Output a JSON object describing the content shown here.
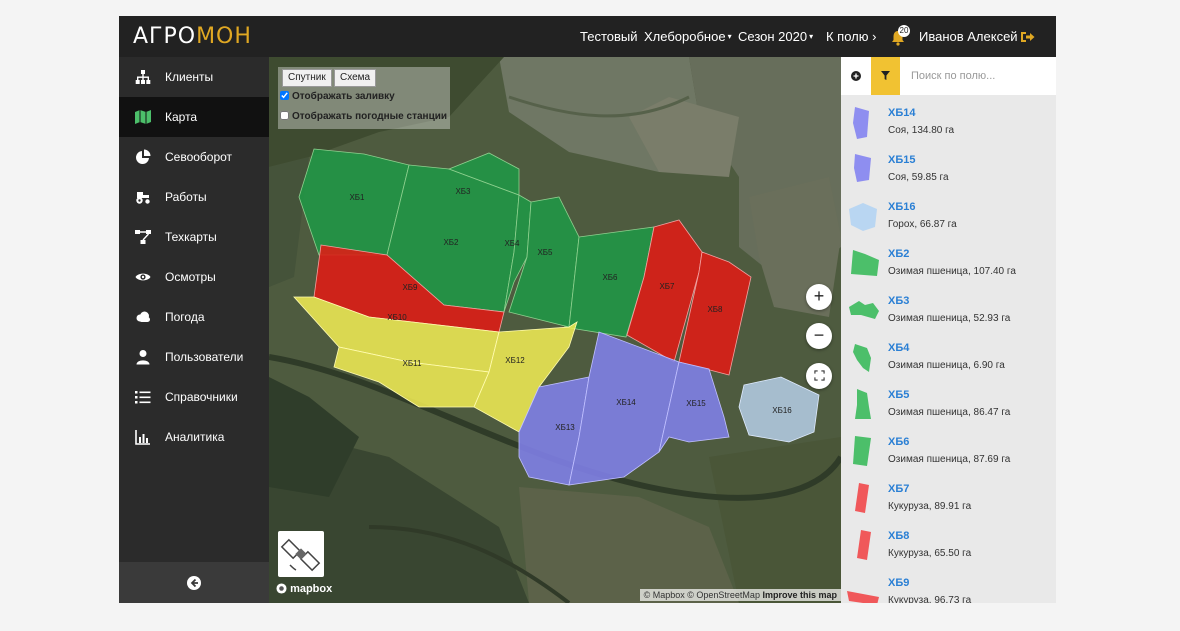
{
  "app": {
    "logo_a": "АГРО",
    "logo_b": "МОН",
    "org": "Тестовый",
    "farm": "Хлеборобное",
    "season": "Сезон 2020",
    "to_field": "К полю",
    "to_field_arrow": "›",
    "caret": "▾",
    "notifications": "20",
    "user": "Иванов Алексей",
    "accent": "#e0a823"
  },
  "sidebar": {
    "items": [
      {
        "label": "Клиенты",
        "icon": "org-chart-icon"
      },
      {
        "label": "Карта",
        "icon": "map-icon"
      },
      {
        "label": "Севооборот",
        "icon": "pie-chart-icon"
      },
      {
        "label": "Работы",
        "icon": "tractor-icon"
      },
      {
        "label": "Техкарты",
        "icon": "flow-icon"
      },
      {
        "label": "Осмотры",
        "icon": "eye-icon"
      },
      {
        "label": "Погода",
        "icon": "cloud-icon"
      },
      {
        "label": "Пользователи",
        "icon": "user-icon"
      },
      {
        "label": "Справочники",
        "icon": "list-icon"
      },
      {
        "label": "Аналитика",
        "icon": "bar-chart-icon"
      }
    ],
    "active": "Карта"
  },
  "map": {
    "tab_satellite": "Спутник",
    "tab_scheme": "Схема",
    "show_fill": "Отображать заливку",
    "show_fill_checked": true,
    "show_weather": "Отображать погодные станции",
    "show_weather_checked": false,
    "zoom_in": "+",
    "zoom_out": "−",
    "mapbox": "mapbox",
    "attribution": "© Mapbox © OpenStreetMap",
    "improve": "Improve this map",
    "labels": {
      "xb1": "ХБ1",
      "xb2": "ХБ2",
      "xb3": "ХБ3",
      "xb4": "ХБ4",
      "xb5": "ХБ5",
      "xb6": "ХБ6",
      "xb7": "ХБ7",
      "xb8": "ХБ8",
      "xb9": "ХБ9",
      "xb10": "ХБ10",
      "xb11": "ХБ11",
      "xb12": "ХБ12",
      "xb13": "ХБ13",
      "xb14": "ХБ14",
      "xb15": "ХБ15",
      "xb16": "ХБ16"
    }
  },
  "crop_colors": {
    "soy": "#8e8ef0",
    "peas": "#b9d6f2",
    "wheat": "#4cbf6a",
    "corn": "#f0585a",
    "sunflower": "#ecec5a"
  },
  "panel": {
    "search_placeholder": "Поиск по полю...",
    "fields": [
      {
        "name": "ХБ14",
        "desc": "Соя, 134.80 га"
      },
      {
        "name": "ХБ15",
        "desc": "Соя, 59.85 га"
      },
      {
        "name": "ХБ16",
        "desc": "Горох, 66.87 га"
      },
      {
        "name": "ХБ2",
        "desc": "Озимая пшеница, 107.40 га"
      },
      {
        "name": "ХБ3",
        "desc": "Озимая пшеница, 52.93 га"
      },
      {
        "name": "ХБ4",
        "desc": "Озимая пшеница, 6.90 га"
      },
      {
        "name": "ХБ5",
        "desc": "Озимая пшеница, 86.47 га"
      },
      {
        "name": "ХБ6",
        "desc": "Озимая пшеница, 87.69 га"
      },
      {
        "name": "ХБ7",
        "desc": "Кукуруза, 89.91 га"
      },
      {
        "name": "ХБ8",
        "desc": "Кукуруза, 65.50 га"
      },
      {
        "name": "ХБ9",
        "desc": "Кукуруза, 96.73 га"
      }
    ]
  }
}
